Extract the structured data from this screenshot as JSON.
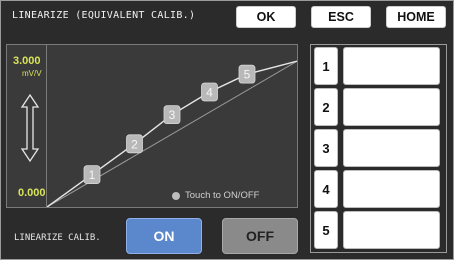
{
  "header": {
    "title": "LINEARIZE (EQUIVALENT CALIB.)",
    "ok_label": "OK",
    "esc_label": "ESC",
    "home_label": "HOME"
  },
  "graph": {
    "y_max_value": "3.000",
    "y_unit": "mV/V",
    "y_min_value": "0.000",
    "touch_hint": "Touch to ON/OFF",
    "point_markers": [
      "1",
      "2",
      "3",
      "4",
      "5"
    ]
  },
  "chart_data": {
    "type": "line",
    "series": [
      {
        "x": [
          0,
          0.18,
          0.35,
          0.5,
          0.65,
          0.8,
          1.0
        ],
        "y": [
          0,
          0.2,
          0.39,
          0.57,
          0.71,
          0.82,
          0.9
        ]
      },
      {
        "x": [
          0,
          1.0
        ],
        "y": [
          0,
          0.9
        ]
      }
    ],
    "xlim": [
      0,
      1
    ],
    "ylim": [
      0,
      1
    ],
    "grid": false
  },
  "bottom": {
    "label": "LINEARIZE CALIB.",
    "on_label": "ON",
    "off_label": "OFF"
  },
  "points": [
    {
      "number": "1",
      "value": ""
    },
    {
      "number": "2",
      "value": ""
    },
    {
      "number": "3",
      "value": ""
    },
    {
      "number": "4",
      "value": ""
    },
    {
      "number": "5",
      "value": ""
    }
  ],
  "colors": {
    "background": "#2b2b2b",
    "accent_on": "#5b87cc",
    "value_text": "#d9e35a"
  }
}
